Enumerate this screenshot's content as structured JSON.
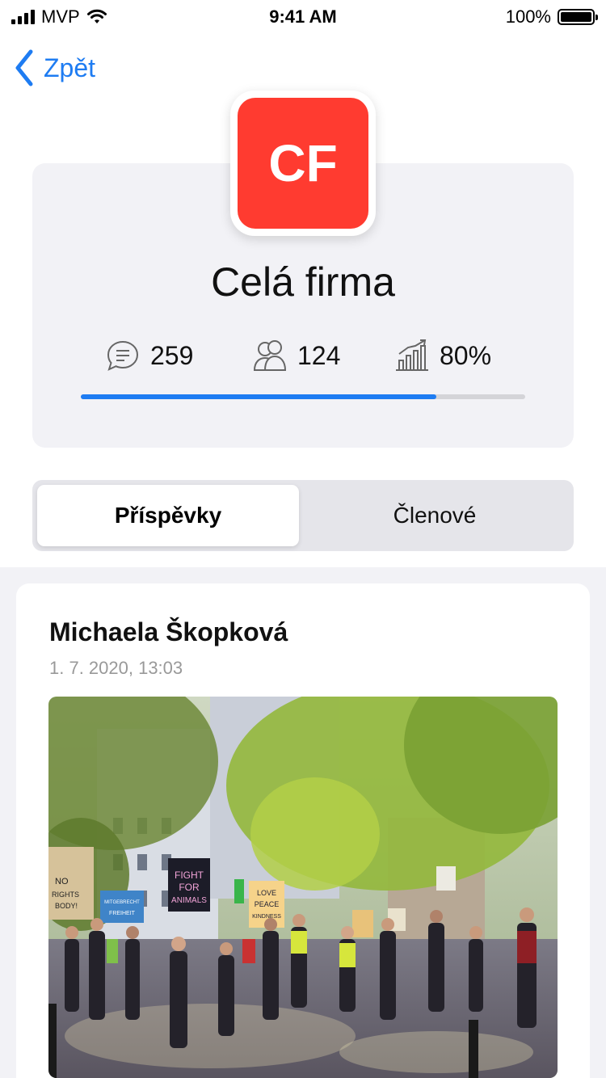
{
  "status_bar": {
    "carrier": "MVP",
    "time": "9:41 AM",
    "battery": "100%"
  },
  "nav": {
    "back_label": "Zpět"
  },
  "group": {
    "avatar_initials": "CF",
    "avatar_color": "#ff3b30",
    "title": "Celá firma",
    "stats": {
      "posts": "259",
      "members": "124",
      "progress": "80%"
    },
    "progress_value": 0.8
  },
  "tabs": {
    "active": "Příspěvky",
    "inactive": "Členové"
  },
  "post": {
    "author": "Michaela Škopková",
    "date": "1. 7. 2020, 13:03",
    "image_signs": [
      "FIGHT FOR ANIMALS",
      "LOVE PEACE KINDNESS",
      "NO RIGHTS BODY!",
      "MITGEBRECHT FREIHEIT"
    ]
  },
  "colors": {
    "accent": "#1e7cf2",
    "card_bg": "#f2f2f6"
  }
}
